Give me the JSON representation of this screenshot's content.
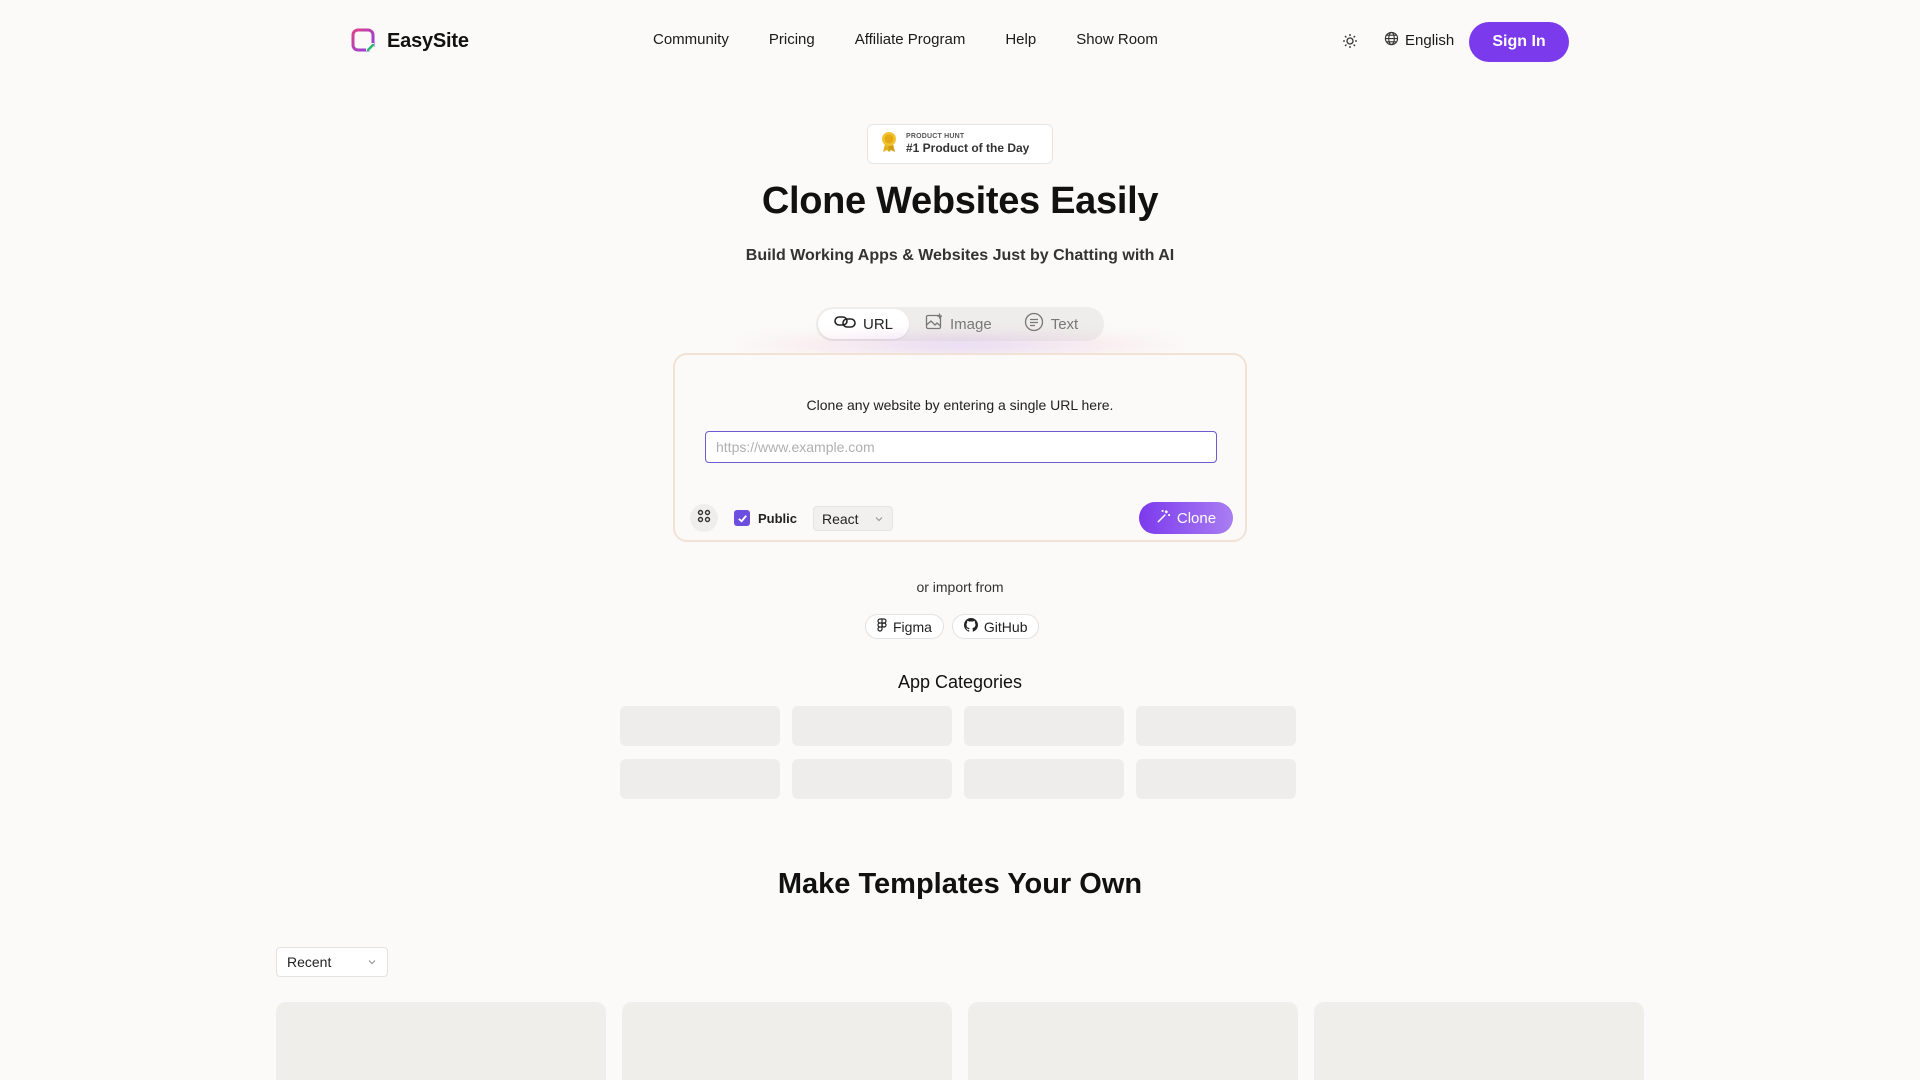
{
  "brand": {
    "name": "EasySite",
    "accent": "#7c3aed"
  },
  "nav": {
    "items": [
      "Community",
      "Pricing",
      "Affiliate Program",
      "Help",
      "Show Room"
    ]
  },
  "header": {
    "theme_icon": "sun-icon",
    "language": "English",
    "sign_in": "Sign In"
  },
  "badge": {
    "kicker": "PRODUCT HUNT",
    "text": "#1 Product of the Day"
  },
  "hero": {
    "title": "Clone Websites Easily",
    "subtitle": "Build Working Apps & Websites Just by Chatting with AI"
  },
  "tabs": [
    {
      "label": "URL",
      "icon": "link-icon",
      "active": true
    },
    {
      "label": "Image",
      "icon": "image-icon",
      "active": false
    },
    {
      "label": "Text",
      "icon": "text-icon",
      "active": false
    }
  ],
  "clone_card": {
    "prompt": "Clone any website by entering a single URL here.",
    "url_value": "",
    "url_placeholder": "https://www.example.com",
    "public_label": "Public",
    "public_checked": true,
    "framework": "React",
    "clone_button": "Clone"
  },
  "import": {
    "label": "or import from",
    "sources": [
      "Figma",
      "GitHub"
    ]
  },
  "categories": {
    "title": "App Categories"
  },
  "templates": {
    "title": "Make Templates Your Own",
    "sort": "Recent"
  }
}
